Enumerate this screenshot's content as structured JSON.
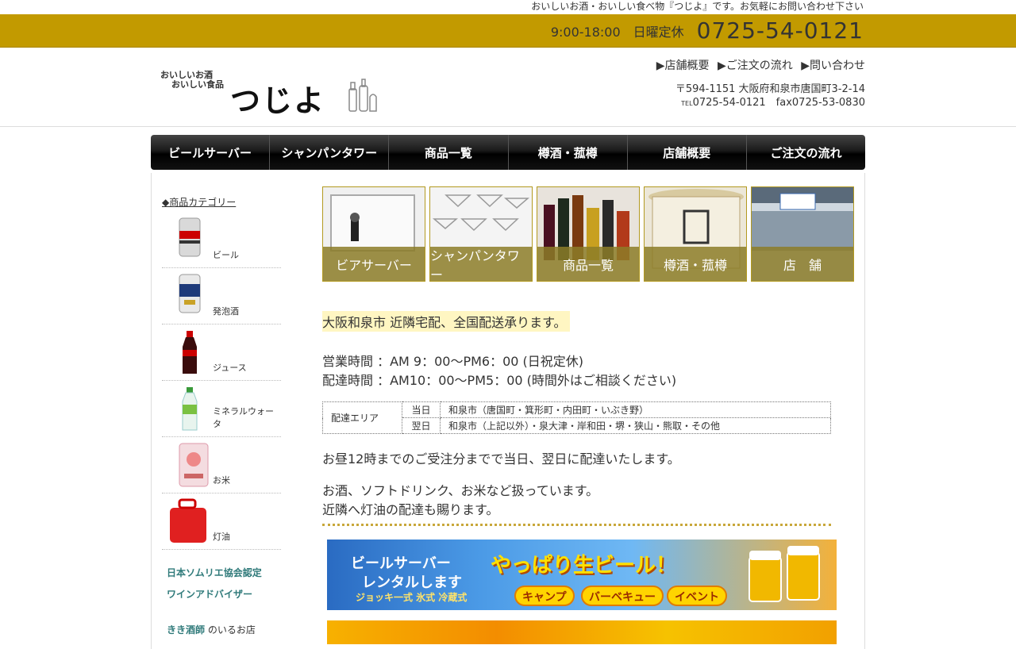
{
  "top": {
    "note": "おいしいお酒・おいしい食べ物『つじよ』です。お気軽にお問い合わせ下さい",
    "hours": "9:00-18:00　日曜定休",
    "phone": "0725-54-0121"
  },
  "header": {
    "logo_tag1": "おいしいお酒",
    "logo_tag2": "おいしい食品",
    "logo_name": "つじよ",
    "links": [
      "▶店舗概要",
      "▶ご注文の流れ",
      "▶問い合わせ"
    ],
    "address": "〒594-1151 大阪府和泉市唐国町3-2-14",
    "tel_label": "TEL",
    "tel": "0725-54-0121　fax0725-53-0830"
  },
  "nav": [
    "ビールサーバー",
    "シャンパンタワー",
    "商品一覧",
    "樽酒・菰樽",
    "店舗概要",
    "ご注文の流れ"
  ],
  "sidebar": {
    "title": "◆商品カテゴリー",
    "categories": [
      "ビール",
      "発泡酒",
      "ジュース",
      "ミネラルウォータ",
      "お米",
      "灯油"
    ],
    "badge1": "日本ソムリエ協会認定",
    "badge2": "ワインアドバイザー",
    "kiki_bold": "きき酒師",
    "kiki_rest": " のいるお店"
  },
  "tiles": [
    "ビアサーバー",
    "シャンパンタワー",
    "商品一覧",
    "樽酒・菰樽",
    "店　舗"
  ],
  "main": {
    "headline": "大阪和泉市 近隣宅配、全国配送承ります。",
    "business_hours": "営業時間 ：AM 9：00〜PM6：00 (日祝定休)",
    "delivery_hours": "配達時間 ：AM10：00〜PM5：00 (時間外はご相談ください)",
    "table": {
      "area_label": "配達エリア",
      "rows": [
        {
          "when": "当日",
          "where": "和泉市（唐国町・箕形町・内田町・いぶき野）"
        },
        {
          "when": "翌日",
          "where": "和泉市（上記以外）・泉大津・岸和田・堺・狭山・熊取・その他"
        }
      ]
    },
    "same_day": "お昼12時までのご受注分までで当日、翌日に配達いたします。",
    "handles": "お酒、ソフトドリンク、お米など扱っています。",
    "kerosene": "近隣へ灯油の配達も賜ります。"
  },
  "banner": {
    "line1": "ビールサーバー",
    "line2": "レンタルします",
    "line3": "ジョッキ一式  氷式  冷蔵式",
    "catch": "やっぱり生ビール！",
    "pills": [
      "キャンプ",
      "バーベキュー",
      "イベント"
    ]
  }
}
